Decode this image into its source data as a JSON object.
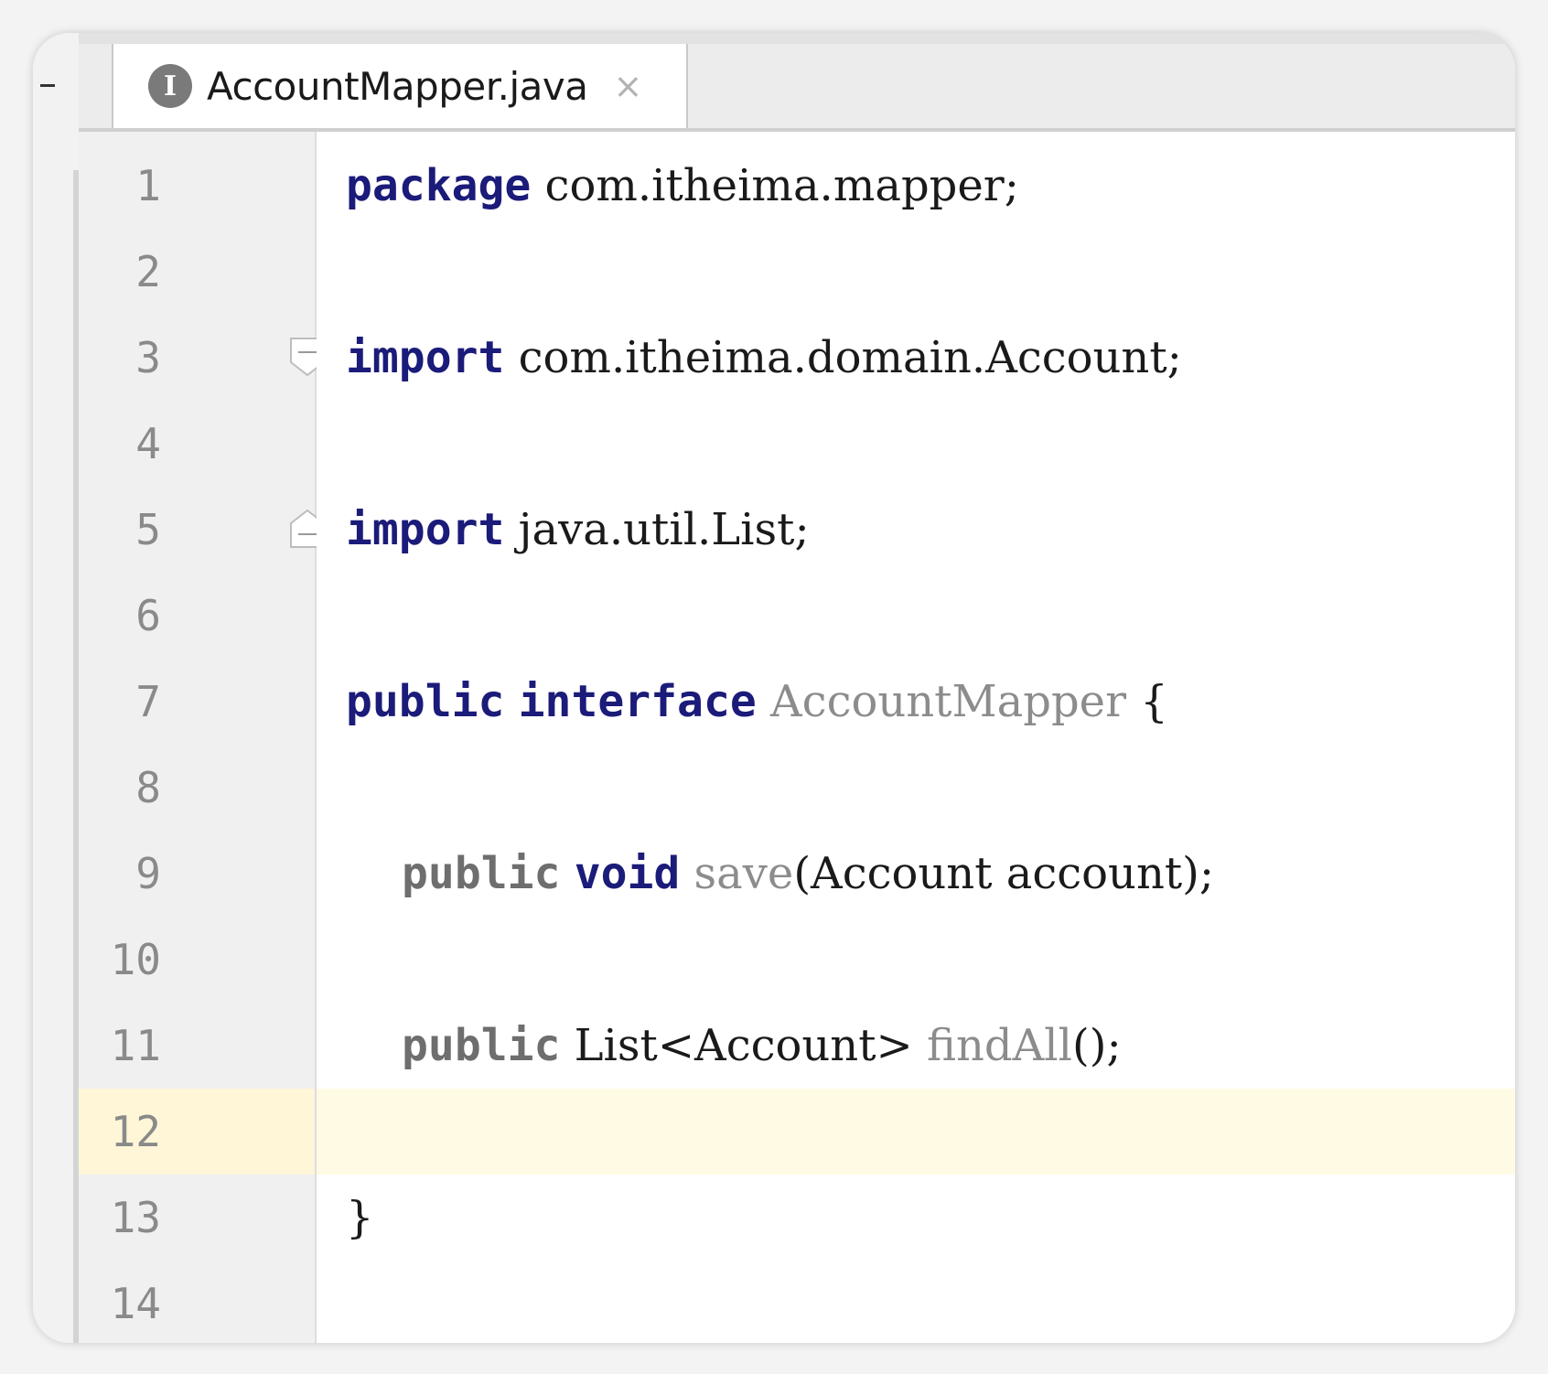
{
  "tab": {
    "icon_letter": "I",
    "title": "AccountMapper.java",
    "close_glyph": "×"
  },
  "editor": {
    "current_line": 12,
    "line_numbers": [
      "1",
      "2",
      "3",
      "4",
      "5",
      "6",
      "7",
      "8",
      "9",
      "10",
      "11",
      "12",
      "13",
      "14"
    ],
    "lines": {
      "l1": {
        "kw": "package",
        "rest": " com.itheima.mapper;"
      },
      "l3": {
        "kw": "import",
        "rest": " com.itheima.domain.Account;"
      },
      "l5": {
        "kw": "import",
        "rest": " java.util.List;"
      },
      "l7": {
        "kw1": "public",
        "kw2": "interface",
        "name": "AccountMapper",
        "rest": " {"
      },
      "l9": {
        "indent": "    ",
        "kw1": "public",
        "kw2": "void",
        "method": "save",
        "rest": "(Account account);"
      },
      "l11": {
        "indent": "    ",
        "kw1": "public",
        "type": " List<Account> ",
        "method": "findAll",
        "rest": "();"
      },
      "l13": {
        "rest": "}"
      }
    }
  },
  "colors": {
    "keyword": "#1b1b7a",
    "current_line": "#fffae3",
    "gutter": "#f0f0f0"
  }
}
